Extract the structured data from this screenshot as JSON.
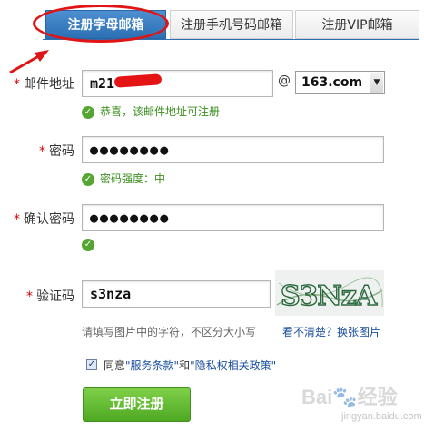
{
  "tabs": [
    {
      "label": "注册字母邮箱",
      "active": true
    },
    {
      "label": "注册手机号码邮箱",
      "active": false
    },
    {
      "label": "注册VIP邮箱",
      "active": false
    }
  ],
  "form": {
    "required_mark": "*",
    "email": {
      "label": "邮件地址",
      "value": "m21",
      "at": "@",
      "domain": "163.com",
      "success": "恭喜，该邮件地址可注册"
    },
    "password": {
      "label": "密码",
      "value": "●●●●●●●●",
      "strength": "密码强度：中"
    },
    "confirm_password": {
      "label": "确认密码",
      "value": "●●●●●●●●"
    },
    "captcha": {
      "label": "验证码",
      "value": "s3nza",
      "image_text": "S3NzA",
      "hint": "请填写图片中的字符，不区分大小写",
      "refresh_link": "看不清楚？换张图片"
    },
    "agreement": {
      "prefix": "同意",
      "terms": "\"服务条款\"",
      "and": "和",
      "privacy": "\"隐私权相关政策\"",
      "checked": true
    },
    "submit_label": "立即注册"
  },
  "annotation": {
    "color": "#e01515"
  },
  "watermark": {
    "main": "Bai🐾经验",
    "sub": "jingyan.baidu.com"
  },
  "colors": {
    "tab_active": "#2c6fb3",
    "success_green": "#3a8f1d",
    "submit_green": "#4ea823",
    "required_red": "#dd0000",
    "link_blue": "#1a4f9c"
  }
}
